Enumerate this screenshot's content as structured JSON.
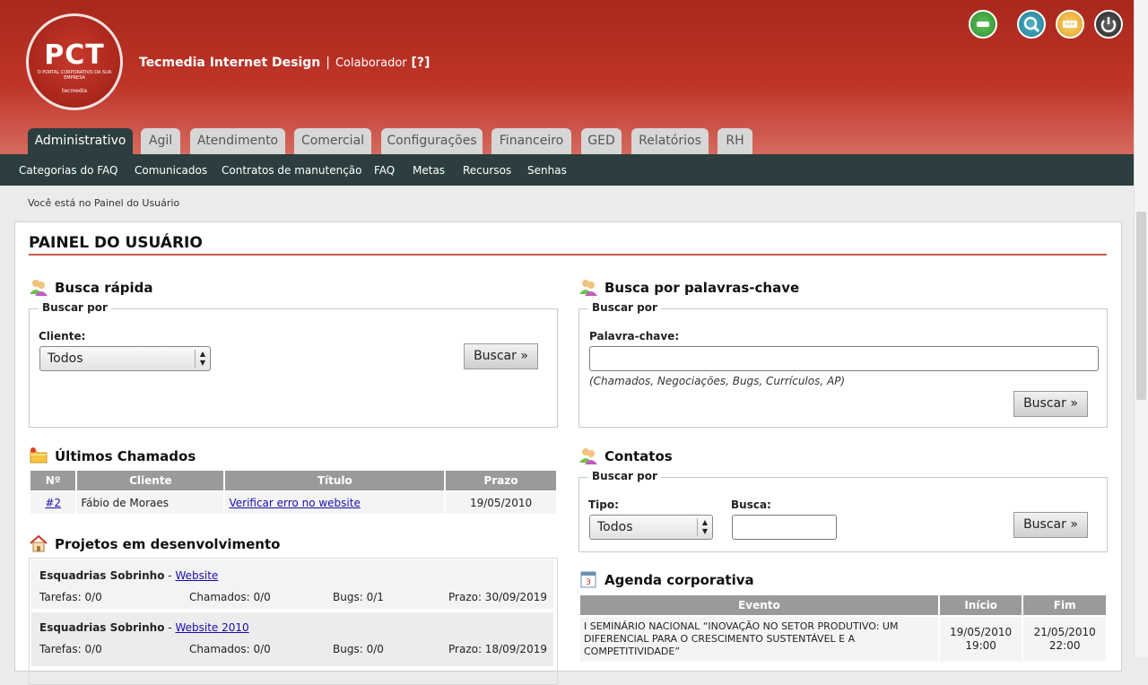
{
  "header": {
    "logo_text": "PCT",
    "logo_sub": "O PORTAL CORPORATIVO DA SUA EMPRESA",
    "logo_brand": "tecmedia",
    "company": "Tecmedia Internet Design",
    "separator": "|",
    "role": "Colaborador",
    "help": "[?]",
    "top_icons": [
      "chat-icon",
      "search-icon",
      "password-icon",
      "power-icon"
    ]
  },
  "tabs": [
    "Administrativo",
    "Agil",
    "Atendimento",
    "Comercial",
    "Configurações",
    "Financeiro",
    "GED",
    "Relatórios",
    "RH"
  ],
  "subnav": [
    "Categorias do FAQ",
    "Comunicados",
    "Contratos de manutenção",
    "FAQ",
    "Metas",
    "Recursos",
    "Senhas"
  ],
  "breadcrumb": "Você está no Painel do Usuário",
  "page_title": "PAINEL DO USUÁRIO",
  "busca_rapida": {
    "title": "Busca rápida",
    "legend": "Buscar por",
    "label": "Cliente:",
    "select_value": "Todos",
    "button": "Buscar »"
  },
  "busca_palavras": {
    "title": "Busca por palavras-chave",
    "legend": "Buscar por",
    "label": "Palavra-chave:",
    "input_value": "",
    "hint": "(Chamados, Negociações, Bugs, Currículos, AP)",
    "button": "Buscar »"
  },
  "chamados": {
    "title": "Últimos Chamados",
    "headers": [
      "Nº",
      "Cliente",
      "Título",
      "Prazo"
    ],
    "rows": [
      {
        "num": "#2",
        "cliente": "Fábio de Moraes",
        "titulo": "Verificar erro no website",
        "prazo": "19/05/2010"
      }
    ]
  },
  "contatos": {
    "title": "Contatos",
    "legend": "Buscar por",
    "tipo_label": "Tipo:",
    "tipo_value": "Todos",
    "busca_label": "Busca:",
    "busca_value": "",
    "button": "Buscar »"
  },
  "projetos": {
    "title": "Projetos em desenvolvimento",
    "items": [
      {
        "cliente": "Esquadrias Sobrinho",
        "dash": "-",
        "projeto": "Website",
        "tarefas": "Tarefas: 0/0",
        "chamados": "Chamados: 0/0",
        "bugs": "Bugs: 0/1",
        "prazo": "Prazo: 30/09/2019"
      },
      {
        "cliente": "Esquadrias Sobrinho",
        "dash": "-",
        "projeto": "Website 2010",
        "tarefas": "Tarefas: 0/0",
        "chamados": "Chamados: 0/0",
        "bugs": "Bugs: 0/0",
        "prazo": "Prazo: 18/09/2019"
      }
    ]
  },
  "agenda": {
    "title": "Agenda corporativa",
    "headers": [
      "Evento",
      "Início",
      "Fim"
    ],
    "rows": [
      {
        "evento": "I SEMINÁRIO NACIONAL “INOVAÇÃO NO SETOR PRODUTIVO: UM DIFERENCIAL PARA O CRESCIMENTO SUSTENTÁVEL E A COMPETITIVIDADE”",
        "inicio_data": "19/05/2010",
        "inicio_hora": "19:00",
        "fim_data": "21/05/2010",
        "fim_hora": "22:00"
      }
    ]
  },
  "colors": {
    "header_red": "#bf3428",
    "dark_nav": "#2c3e3f",
    "table_header": "#9a9a9a",
    "title_rule": "#c75c52"
  }
}
